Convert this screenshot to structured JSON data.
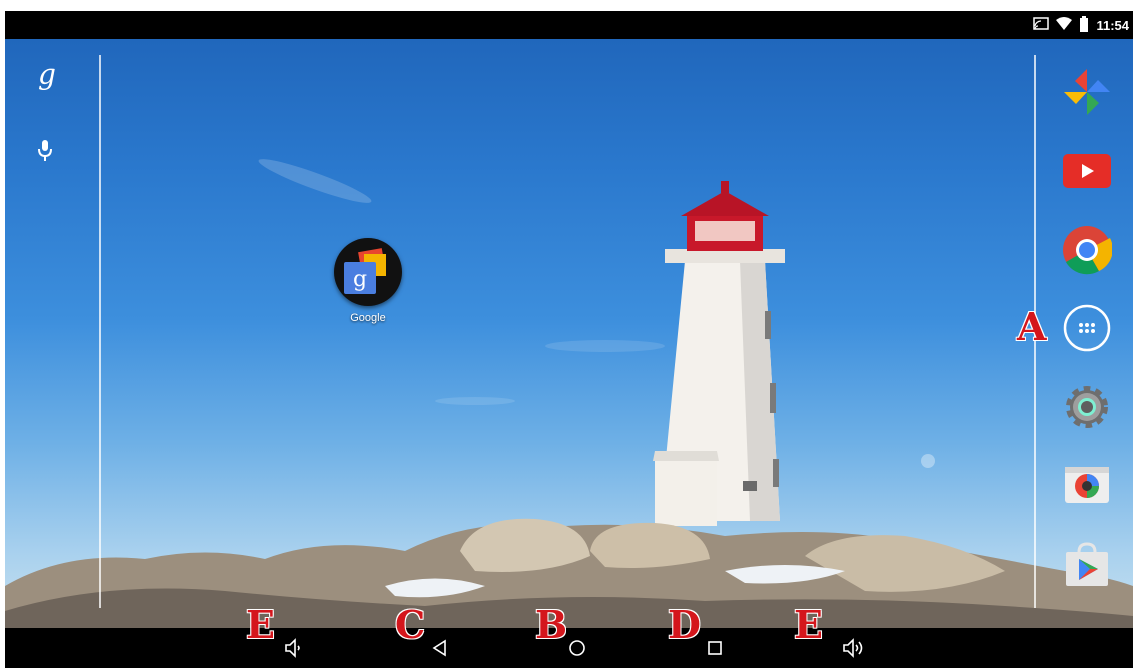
{
  "status_bar": {
    "time": "11:54",
    "icons": [
      "cast-icon",
      "wifi-icon",
      "battery-icon"
    ]
  },
  "search_panel": {
    "icons": [
      "google-search-icon",
      "microphone-icon"
    ]
  },
  "desktop": {
    "app": {
      "label": "Google",
      "icon": "google-folder-icon"
    }
  },
  "dock": {
    "apps": [
      "photos-icon",
      "youtube-icon",
      "chrome-icon",
      "app-drawer-icon",
      "settings-icon",
      "camera-icon",
      "play-store-icon"
    ]
  },
  "nav_bar": {
    "buttons": [
      "volume-down-icon",
      "back-icon",
      "home-icon",
      "recents-icon",
      "volume-up-icon"
    ]
  },
  "callouts": {
    "a": "A",
    "b": "B",
    "c": "C",
    "d": "D",
    "e_left": "E",
    "e_right": "E"
  },
  "colors": {
    "callout": "#d4161c",
    "status_bar": "#000000",
    "nav_bar": "#000000"
  }
}
